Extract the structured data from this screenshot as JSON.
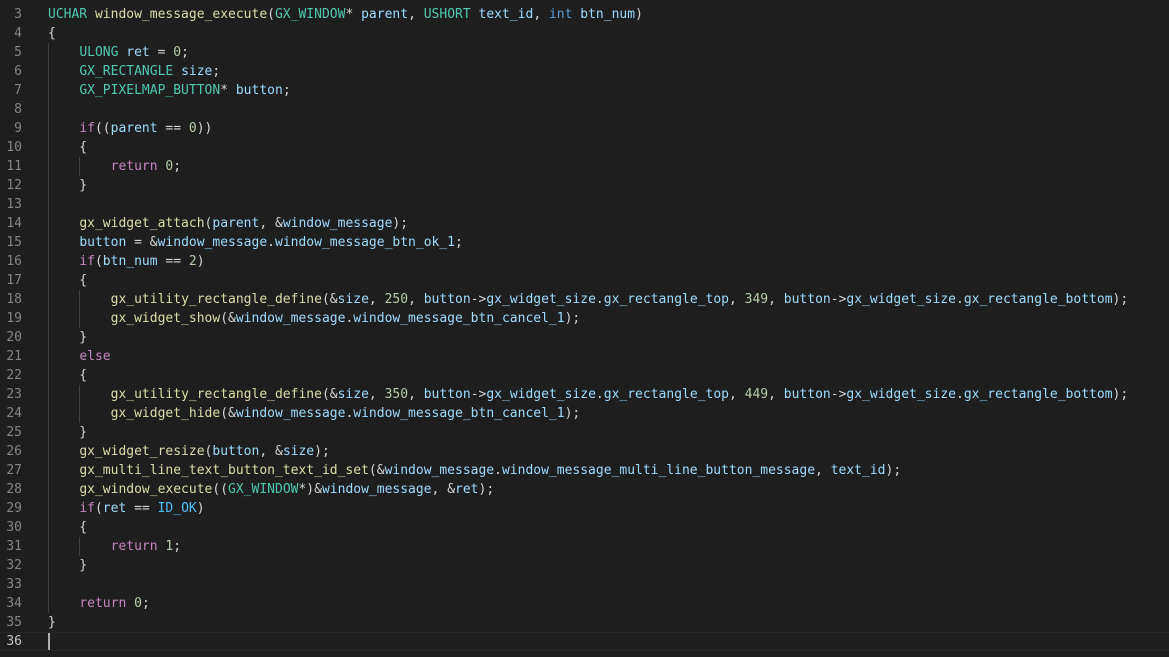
{
  "editor": {
    "language": "C",
    "theme_colors": {
      "background": "#1e1e1e",
      "type": "#4ec9b0",
      "function": "#dcdcaa",
      "keyword": "#c586c0",
      "builtin": "#569cd6",
      "number": "#b5cea8",
      "variable": "#9cdcfe",
      "constant": "#4fc1ff",
      "plain": "#d4d4d4",
      "line_number": "#858585"
    },
    "current_line": 36,
    "lines": [
      {
        "n": "3",
        "tokens": [
          [
            "tp",
            "UCHAR"
          ],
          [
            "op",
            " "
          ],
          [
            "fn",
            "window_message_execute"
          ],
          [
            "op",
            "("
          ],
          [
            "tp",
            "GX_WINDOW"
          ],
          [
            "op",
            "* "
          ],
          [
            "var",
            "parent"
          ],
          [
            "op",
            ", "
          ],
          [
            "tp",
            "USHORT"
          ],
          [
            "op",
            " "
          ],
          [
            "var",
            "text_id"
          ],
          [
            "op",
            ", "
          ],
          [
            "bi",
            "int"
          ],
          [
            "op",
            " "
          ],
          [
            "var",
            "btn_num"
          ],
          [
            "op",
            ")"
          ]
        ]
      },
      {
        "n": "4",
        "tokens": [
          [
            "op",
            "{"
          ]
        ]
      },
      {
        "n": "5",
        "tokens": [
          [
            "op",
            "    "
          ],
          [
            "tp",
            "ULONG"
          ],
          [
            "op",
            " "
          ],
          [
            "var",
            "ret"
          ],
          [
            "op",
            " = "
          ],
          [
            "num",
            "0"
          ],
          [
            "op",
            ";"
          ]
        ]
      },
      {
        "n": "6",
        "tokens": [
          [
            "op",
            "    "
          ],
          [
            "tp",
            "GX_RECTANGLE"
          ],
          [
            "op",
            " "
          ],
          [
            "var",
            "size"
          ],
          [
            "op",
            ";"
          ]
        ]
      },
      {
        "n": "7",
        "tokens": [
          [
            "op",
            "    "
          ],
          [
            "tp",
            "GX_PIXELMAP_BUTTON"
          ],
          [
            "op",
            "* "
          ],
          [
            "var",
            "button"
          ],
          [
            "op",
            ";"
          ]
        ]
      },
      {
        "n": "8",
        "tokens": []
      },
      {
        "n": "9",
        "tokens": [
          [
            "op",
            "    "
          ],
          [
            "kw",
            "if"
          ],
          [
            "op",
            "(("
          ],
          [
            "var",
            "parent"
          ],
          [
            "op",
            " == "
          ],
          [
            "num",
            "0"
          ],
          [
            "op",
            "))"
          ]
        ]
      },
      {
        "n": "10",
        "tokens": [
          [
            "op",
            "    {"
          ]
        ]
      },
      {
        "n": "11",
        "tokens": [
          [
            "op",
            "        "
          ],
          [
            "kw",
            "return"
          ],
          [
            "op",
            " "
          ],
          [
            "num",
            "0"
          ],
          [
            "op",
            ";"
          ]
        ]
      },
      {
        "n": "12",
        "tokens": [
          [
            "op",
            "    }"
          ]
        ]
      },
      {
        "n": "13",
        "tokens": []
      },
      {
        "n": "14",
        "tokens": [
          [
            "op",
            "    "
          ],
          [
            "fn",
            "gx_widget_attach"
          ],
          [
            "op",
            "("
          ],
          [
            "var",
            "parent"
          ],
          [
            "op",
            ", &"
          ],
          [
            "var",
            "window_message"
          ],
          [
            "op",
            ");"
          ]
        ]
      },
      {
        "n": "15",
        "tokens": [
          [
            "op",
            "    "
          ],
          [
            "var",
            "button"
          ],
          [
            "op",
            " = &"
          ],
          [
            "var",
            "window_message"
          ],
          [
            "op",
            "."
          ],
          [
            "var",
            "window_message_btn_ok_1"
          ],
          [
            "op",
            ";"
          ]
        ]
      },
      {
        "n": "16",
        "tokens": [
          [
            "op",
            "    "
          ],
          [
            "kw",
            "if"
          ],
          [
            "op",
            "("
          ],
          [
            "var",
            "btn_num"
          ],
          [
            "op",
            " == "
          ],
          [
            "num",
            "2"
          ],
          [
            "op",
            ")"
          ]
        ]
      },
      {
        "n": "17",
        "tokens": [
          [
            "op",
            "    {"
          ]
        ]
      },
      {
        "n": "18",
        "tokens": [
          [
            "op",
            "        "
          ],
          [
            "fn",
            "gx_utility_rectangle_define"
          ],
          [
            "op",
            "(&"
          ],
          [
            "var",
            "size"
          ],
          [
            "op",
            ", "
          ],
          [
            "num",
            "250"
          ],
          [
            "op",
            ", "
          ],
          [
            "var",
            "button"
          ],
          [
            "op",
            "->"
          ],
          [
            "var",
            "gx_widget_size"
          ],
          [
            "op",
            "."
          ],
          [
            "var",
            "gx_rectangle_top"
          ],
          [
            "op",
            ", "
          ],
          [
            "num",
            "349"
          ],
          [
            "op",
            ", "
          ],
          [
            "var",
            "button"
          ],
          [
            "op",
            "->"
          ],
          [
            "var",
            "gx_widget_size"
          ],
          [
            "op",
            "."
          ],
          [
            "var",
            "gx_rectangle_bottom"
          ],
          [
            "op",
            ");"
          ]
        ]
      },
      {
        "n": "19",
        "tokens": [
          [
            "op",
            "        "
          ],
          [
            "fn",
            "gx_widget_show"
          ],
          [
            "op",
            "(&"
          ],
          [
            "var",
            "window_message"
          ],
          [
            "op",
            "."
          ],
          [
            "var",
            "window_message_btn_cancel_1"
          ],
          [
            "op",
            ");"
          ]
        ]
      },
      {
        "n": "20",
        "tokens": [
          [
            "op",
            "    }"
          ]
        ]
      },
      {
        "n": "21",
        "tokens": [
          [
            "op",
            "    "
          ],
          [
            "kw",
            "else"
          ]
        ]
      },
      {
        "n": "22",
        "tokens": [
          [
            "op",
            "    {"
          ]
        ]
      },
      {
        "n": "23",
        "tokens": [
          [
            "op",
            "        "
          ],
          [
            "fn",
            "gx_utility_rectangle_define"
          ],
          [
            "op",
            "(&"
          ],
          [
            "var",
            "size"
          ],
          [
            "op",
            ", "
          ],
          [
            "num",
            "350"
          ],
          [
            "op",
            ", "
          ],
          [
            "var",
            "button"
          ],
          [
            "op",
            "->"
          ],
          [
            "var",
            "gx_widget_size"
          ],
          [
            "op",
            "."
          ],
          [
            "var",
            "gx_rectangle_top"
          ],
          [
            "op",
            ", "
          ],
          [
            "num",
            "449"
          ],
          [
            "op",
            ", "
          ],
          [
            "var",
            "button"
          ],
          [
            "op",
            "->"
          ],
          [
            "var",
            "gx_widget_size"
          ],
          [
            "op",
            "."
          ],
          [
            "var",
            "gx_rectangle_bottom"
          ],
          [
            "op",
            ");"
          ]
        ]
      },
      {
        "n": "24",
        "tokens": [
          [
            "op",
            "        "
          ],
          [
            "fn",
            "gx_widget_hide"
          ],
          [
            "op",
            "(&"
          ],
          [
            "var",
            "window_message"
          ],
          [
            "op",
            "."
          ],
          [
            "var",
            "window_message_btn_cancel_1"
          ],
          [
            "op",
            ");"
          ]
        ]
      },
      {
        "n": "25",
        "tokens": [
          [
            "op",
            "    }"
          ]
        ]
      },
      {
        "n": "26",
        "tokens": [
          [
            "op",
            "    "
          ],
          [
            "fn",
            "gx_widget_resize"
          ],
          [
            "op",
            "("
          ],
          [
            "var",
            "button"
          ],
          [
            "op",
            ", &"
          ],
          [
            "var",
            "size"
          ],
          [
            "op",
            ");"
          ]
        ]
      },
      {
        "n": "27",
        "tokens": [
          [
            "op",
            "    "
          ],
          [
            "fn",
            "gx_multi_line_text_button_text_id_set"
          ],
          [
            "op",
            "(&"
          ],
          [
            "var",
            "window_message"
          ],
          [
            "op",
            "."
          ],
          [
            "var",
            "window_message_multi_line_button_message"
          ],
          [
            "op",
            ", "
          ],
          [
            "var",
            "text_id"
          ],
          [
            "op",
            ");"
          ]
        ]
      },
      {
        "n": "28",
        "tokens": [
          [
            "op",
            "    "
          ],
          [
            "fn",
            "gx_window_execute"
          ],
          [
            "op",
            "(("
          ],
          [
            "tp",
            "GX_WINDOW"
          ],
          [
            "op",
            "*)&"
          ],
          [
            "var",
            "window_message"
          ],
          [
            "op",
            ", &"
          ],
          [
            "var",
            "ret"
          ],
          [
            "op",
            ");"
          ]
        ]
      },
      {
        "n": "29",
        "tokens": [
          [
            "op",
            "    "
          ],
          [
            "kw",
            "if"
          ],
          [
            "op",
            "("
          ],
          [
            "var",
            "ret"
          ],
          [
            "op",
            " == "
          ],
          [
            "const",
            "ID_OK"
          ],
          [
            "op",
            ")"
          ]
        ]
      },
      {
        "n": "30",
        "tokens": [
          [
            "op",
            "    {"
          ]
        ]
      },
      {
        "n": "31",
        "tokens": [
          [
            "op",
            "        "
          ],
          [
            "kw",
            "return"
          ],
          [
            "op",
            " "
          ],
          [
            "num",
            "1"
          ],
          [
            "op",
            ";"
          ]
        ]
      },
      {
        "n": "32",
        "tokens": [
          [
            "op",
            "    }"
          ]
        ]
      },
      {
        "n": "33",
        "tokens": []
      },
      {
        "n": "34",
        "tokens": [
          [
            "op",
            "    "
          ],
          [
            "kw",
            "return"
          ],
          [
            "op",
            " "
          ],
          [
            "num",
            "0"
          ],
          [
            "op",
            ";"
          ]
        ]
      },
      {
        "n": "35",
        "tokens": [
          [
            "op",
            "}"
          ]
        ]
      },
      {
        "n": "36",
        "tokens": []
      }
    ]
  }
}
